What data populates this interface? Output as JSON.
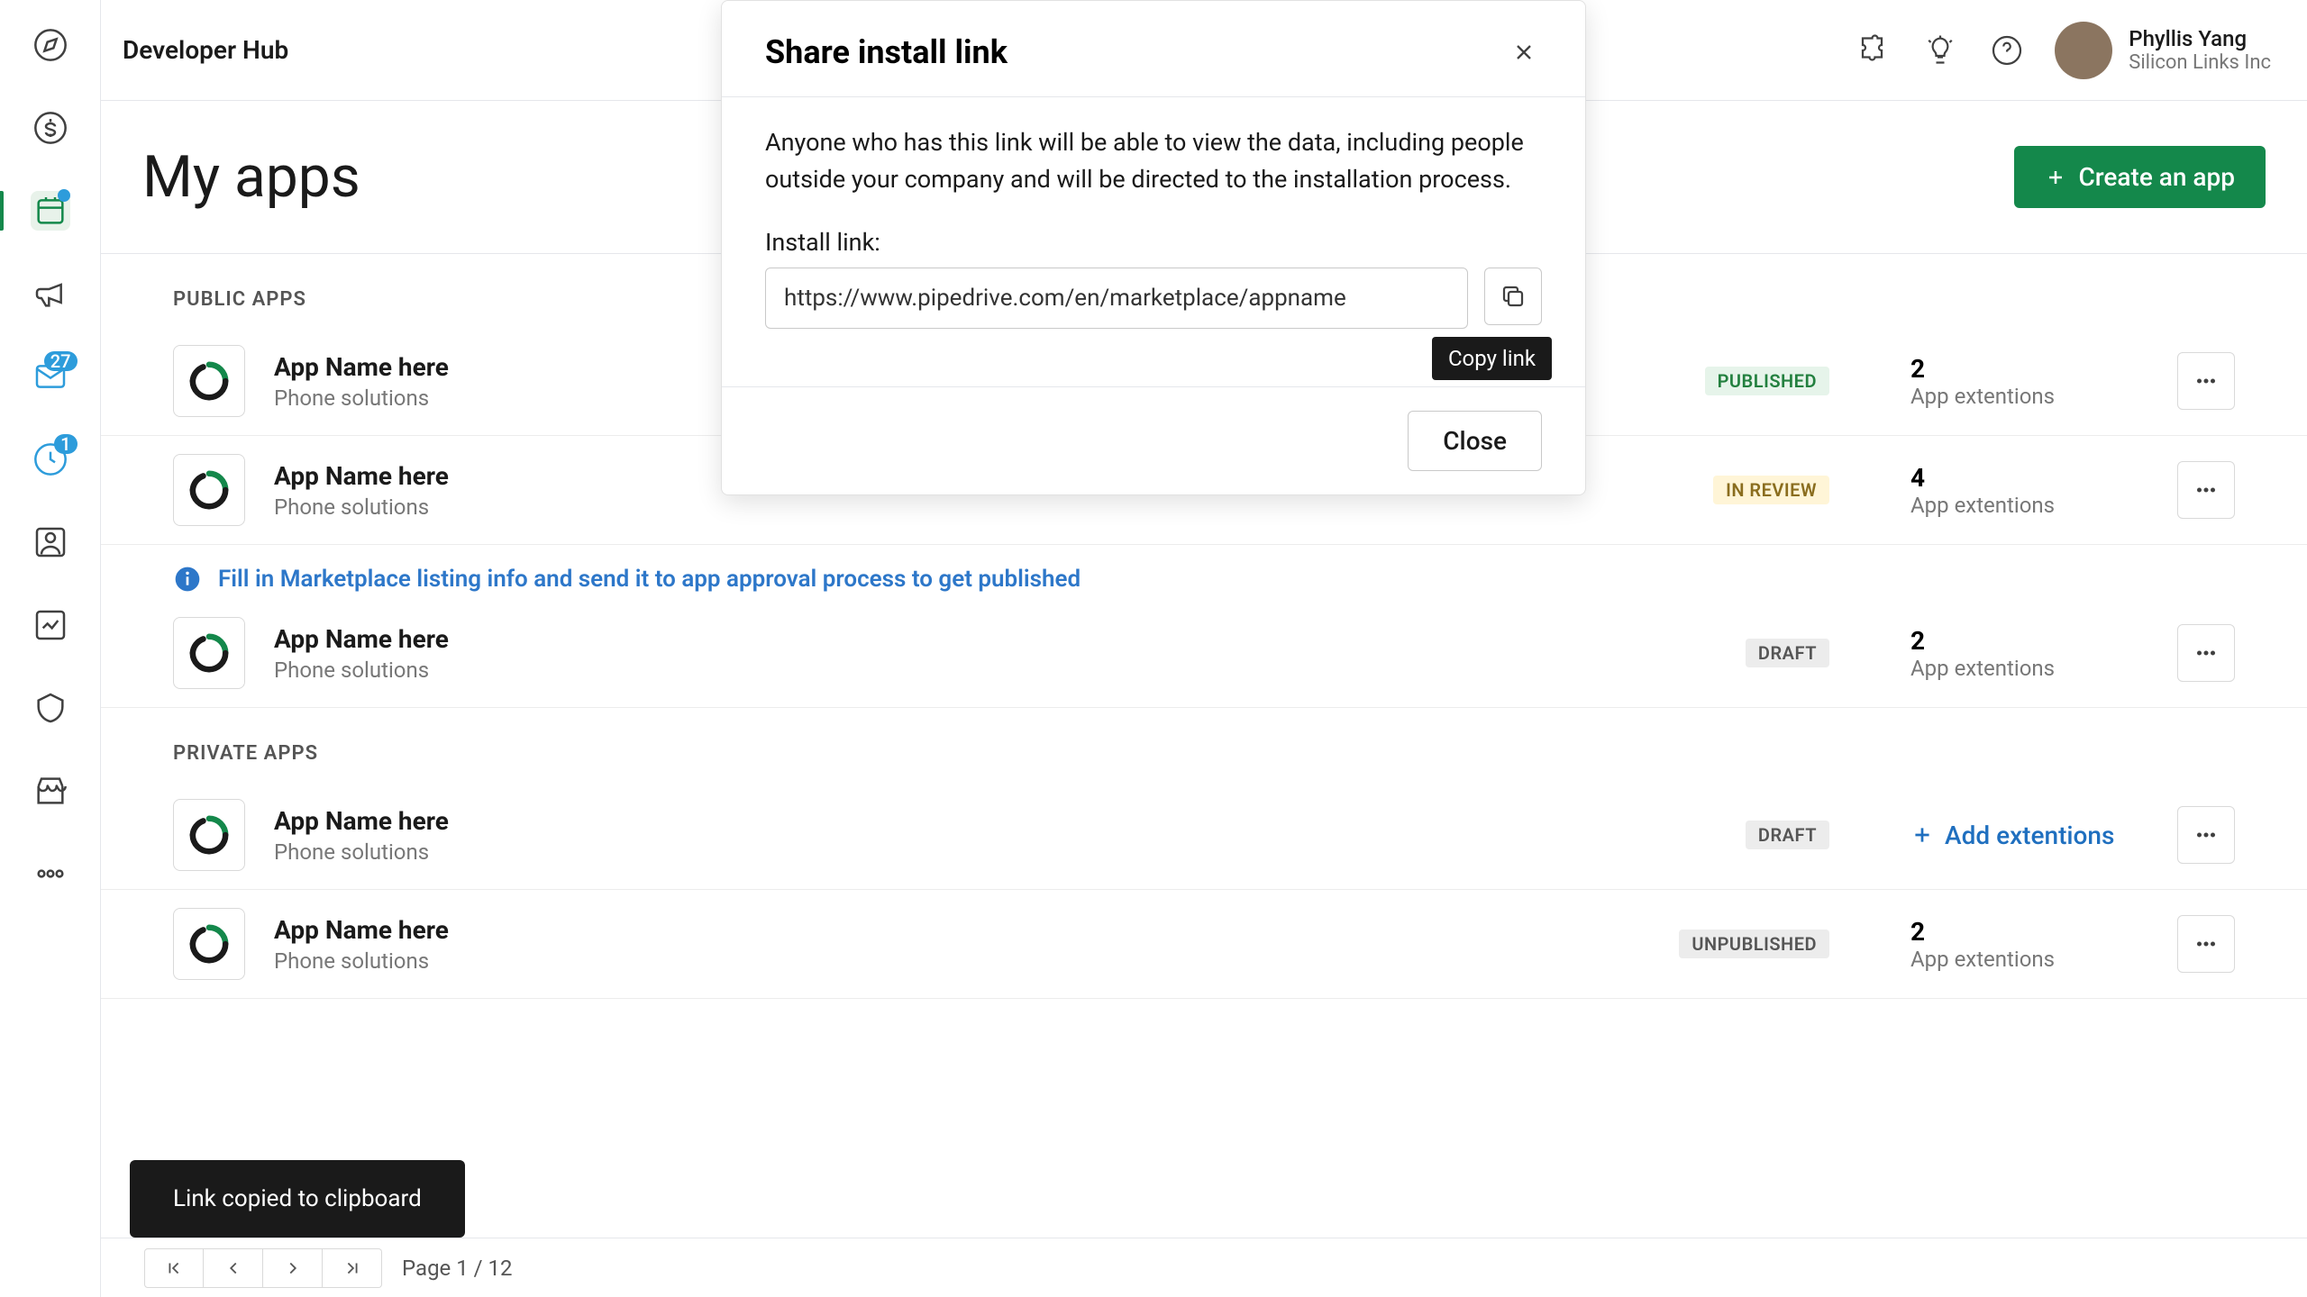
{
  "topbar": {
    "title": "Developer Hub",
    "user_name": "Phyllis Yang",
    "user_org": "Silicon Links Inc"
  },
  "nav_badge": "27",
  "nav_notif_badge": "1",
  "page": {
    "heading": "My apps",
    "create_label": "Create an app"
  },
  "sections": {
    "public_label": "PUBLIC APPS",
    "private_label": "PRIVATE APPS"
  },
  "apps_public": [
    {
      "name": "App Name here",
      "sub": "Phone solutions",
      "status": "PUBLISHED",
      "status_cls": "pub",
      "ext_n": "2",
      "ext_t": "App extentions"
    },
    {
      "name": "App Name here",
      "sub": "Phone solutions",
      "status": "IN REVIEW",
      "status_cls": "rev",
      "ext_n": "4",
      "ext_t": "App extentions"
    },
    {
      "name": "App Name here",
      "sub": "Phone solutions",
      "status": "DRAFT",
      "status_cls": "draft",
      "ext_n": "2",
      "ext_t": "App extentions",
      "warn": "Fill in Marketplace listing info and send it to app approval process to get published"
    }
  ],
  "apps_private": [
    {
      "name": "App Name here",
      "sub": "Phone solutions",
      "status": "DRAFT",
      "status_cls": "draft",
      "add_ext": "Add extentions"
    },
    {
      "name": "App Name here",
      "sub": "Phone solutions",
      "status": "UNPUBLISHED",
      "status_cls": "unpub",
      "ext_n": "2",
      "ext_t": "App extentions"
    }
  ],
  "pager": {
    "text": "Page 1 / 12"
  },
  "toast": "Link copied to clipboard",
  "modal": {
    "title": "Share install link",
    "body": "Anyone who has this link will be able to view the data, including people outside your company and will be directed to the installation process.",
    "label": "Install link:",
    "url": "https://www.pipedrive.com/en/marketplace/appname",
    "tooltip": "Copy link",
    "close": "Close"
  }
}
